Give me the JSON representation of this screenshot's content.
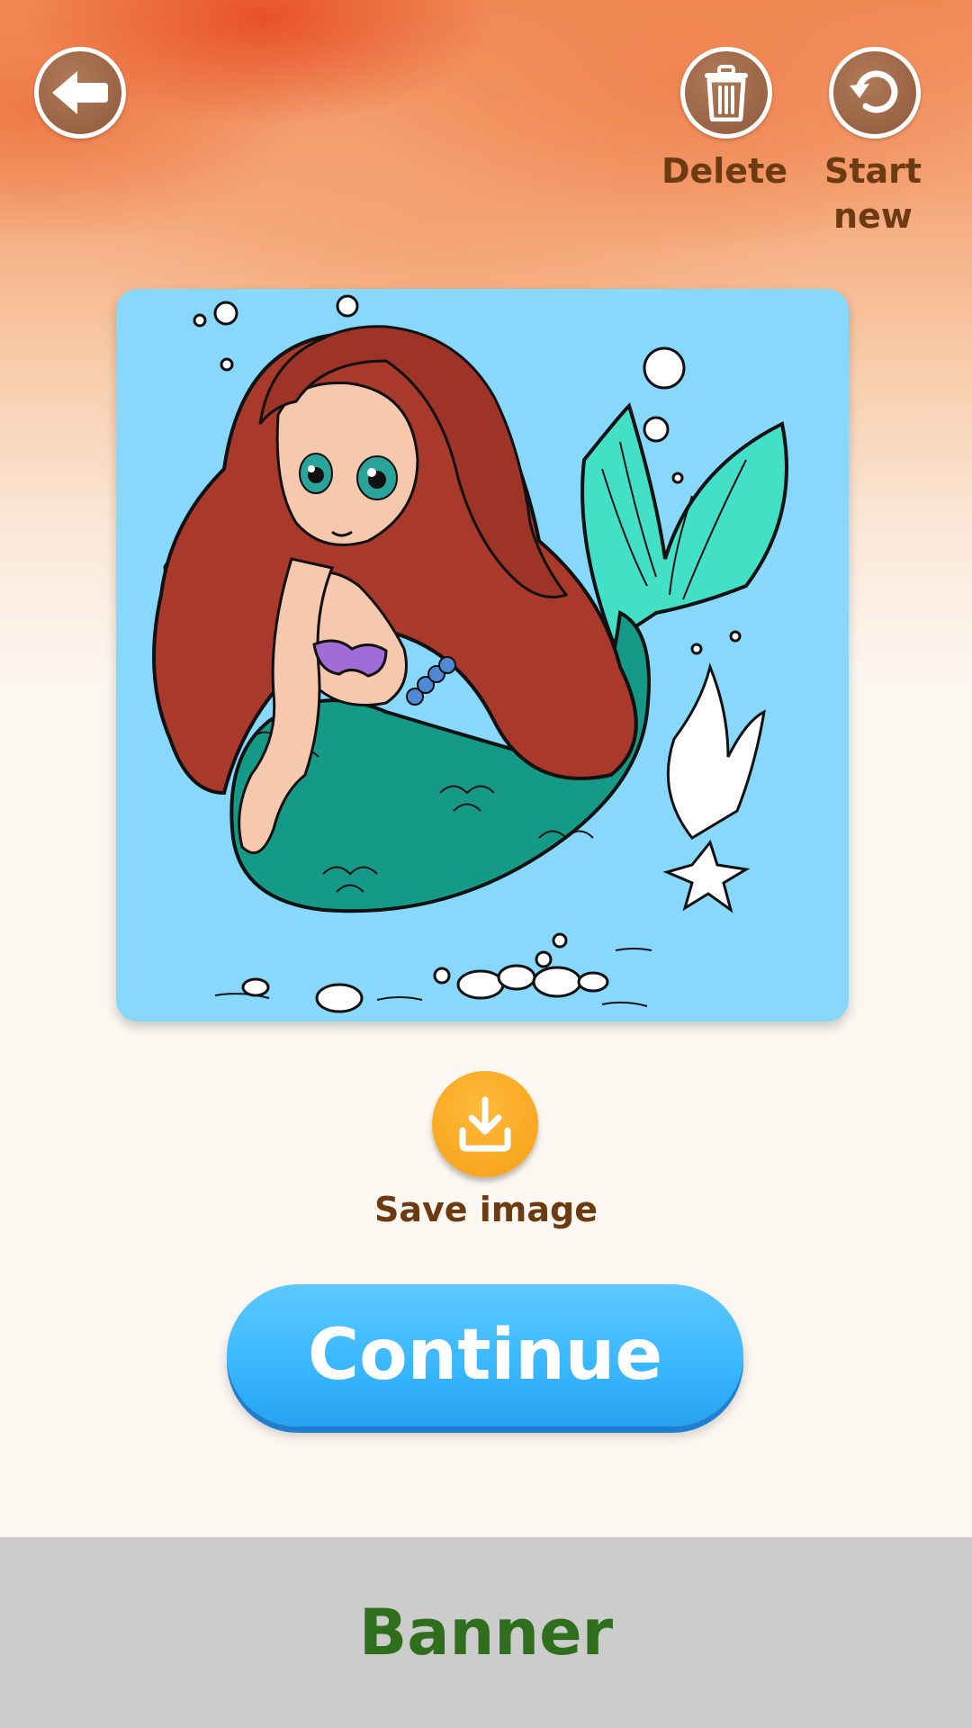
{
  "header": {
    "back_icon": "back-arrow-icon",
    "delete": {
      "label": "Delete",
      "icon": "trash-icon"
    },
    "start_new": {
      "label": "Start\nnew",
      "icon": "restart-icon"
    }
  },
  "artwork": {
    "subject": "mermaid coloring picture",
    "background_color": "#87d8fb"
  },
  "save": {
    "label": "Save image",
    "icon": "download-icon",
    "color": "#f5a623"
  },
  "continue": {
    "label": "Continue",
    "color": "#38b6ff"
  },
  "banner": {
    "label": "Banner"
  },
  "colors": {
    "text_brown": "#6d3b12",
    "banner_green": "#2e6e1c",
    "banner_bg": "#cccccc"
  }
}
